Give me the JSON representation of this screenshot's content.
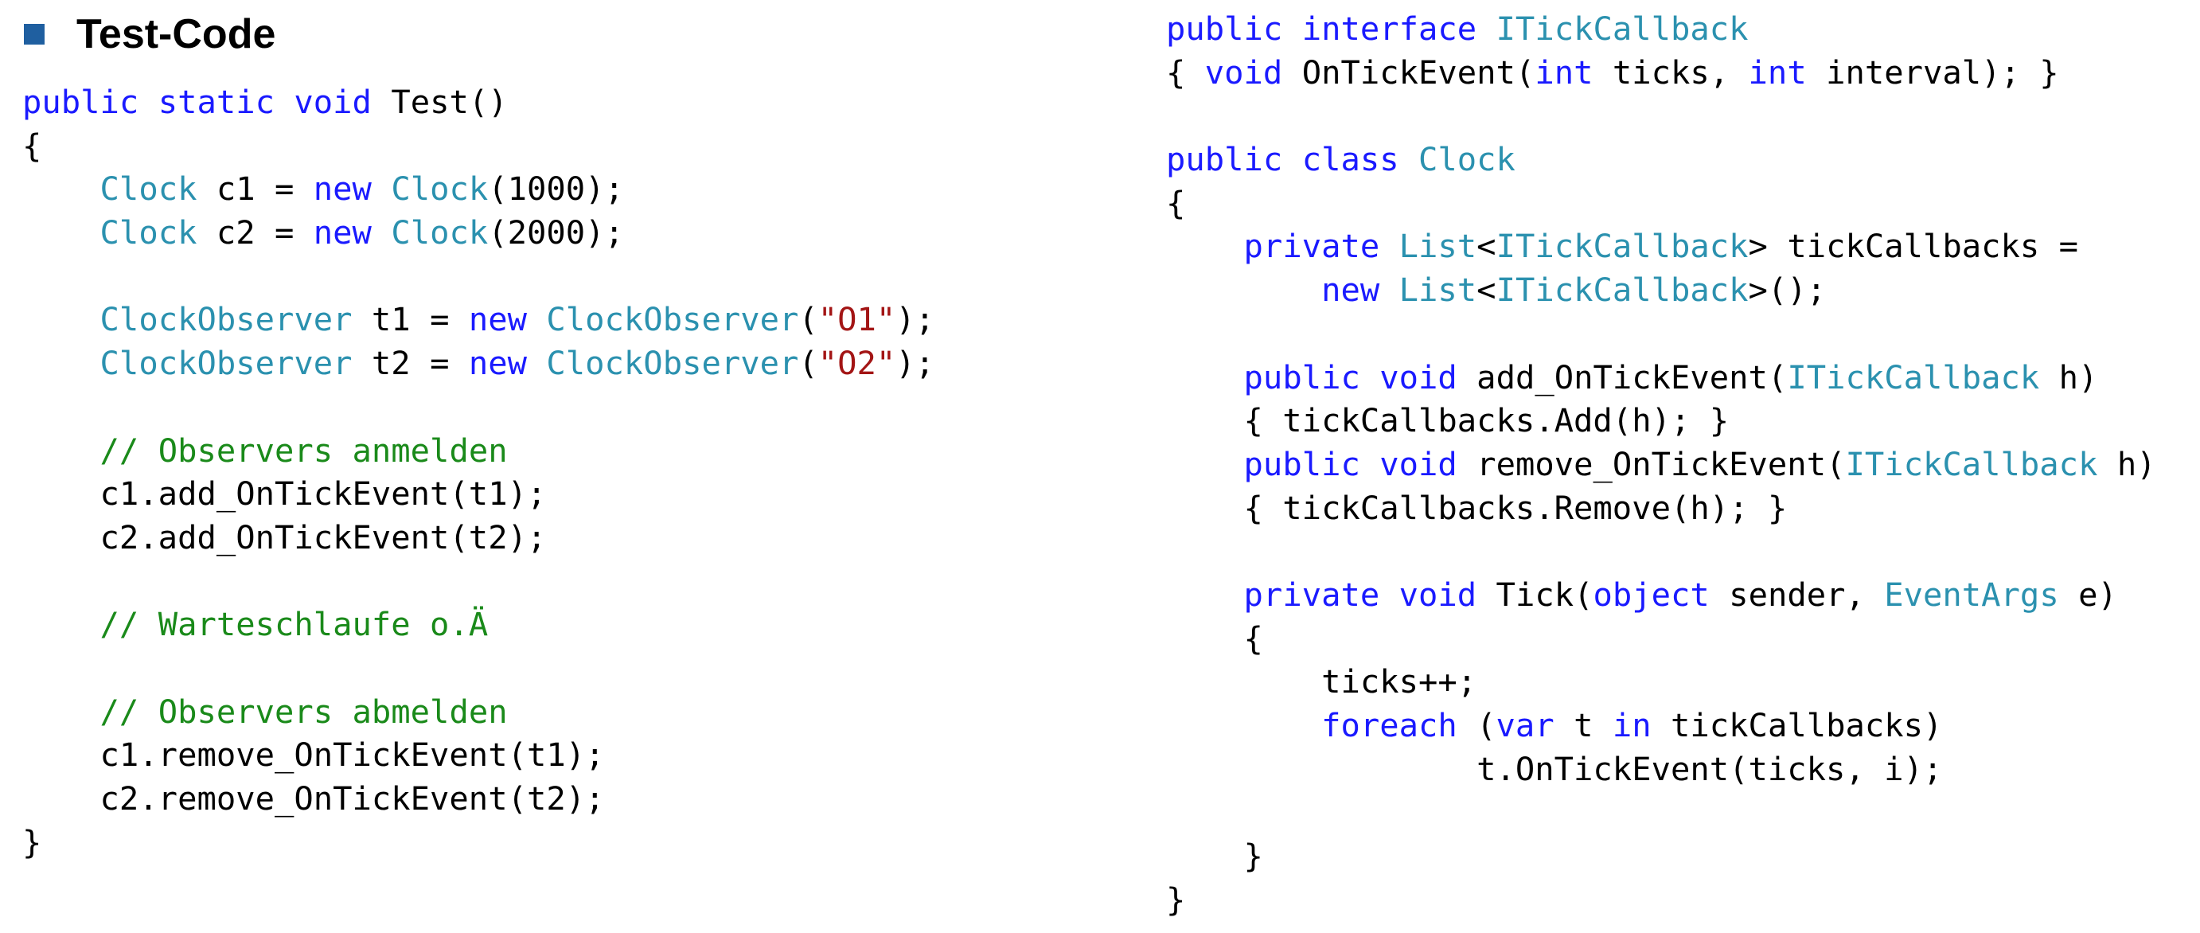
{
  "slide": {
    "title": "Test-Code"
  },
  "colors": {
    "keyword": "#1a1aff",
    "type": "#2b91af",
    "string": "#a31515",
    "comment": "#1a8a1a",
    "plain": "#000000",
    "bullet": "#1f5fa0"
  },
  "left_code": [
    [
      [
        "kw",
        "public"
      ],
      [
        "pl",
        " "
      ],
      [
        "kw",
        "static"
      ],
      [
        "pl",
        " "
      ],
      [
        "kw",
        "void"
      ],
      [
        "pl",
        " Test()"
      ]
    ],
    [
      [
        "pl",
        "{"
      ]
    ],
    [
      [
        "pl",
        "    "
      ],
      [
        "ty",
        "Clock"
      ],
      [
        "pl",
        " c1 = "
      ],
      [
        "kw",
        "new"
      ],
      [
        "pl",
        " "
      ],
      [
        "ty",
        "Clock"
      ],
      [
        "pl",
        "(1000);"
      ]
    ],
    [
      [
        "pl",
        "    "
      ],
      [
        "ty",
        "Clock"
      ],
      [
        "pl",
        " c2 = "
      ],
      [
        "kw",
        "new"
      ],
      [
        "pl",
        " "
      ],
      [
        "ty",
        "Clock"
      ],
      [
        "pl",
        "(2000);"
      ]
    ],
    [],
    [
      [
        "pl",
        "    "
      ],
      [
        "ty",
        "ClockObserver"
      ],
      [
        "pl",
        " t1 = "
      ],
      [
        "kw",
        "new"
      ],
      [
        "pl",
        " "
      ],
      [
        "ty",
        "ClockObserver"
      ],
      [
        "pl",
        "("
      ],
      [
        "st",
        "\"O1\""
      ],
      [
        "pl",
        ");"
      ]
    ],
    [
      [
        "pl",
        "    "
      ],
      [
        "ty",
        "ClockObserver"
      ],
      [
        "pl",
        " t2 = "
      ],
      [
        "kw",
        "new"
      ],
      [
        "pl",
        " "
      ],
      [
        "ty",
        "ClockObserver"
      ],
      [
        "pl",
        "("
      ],
      [
        "st",
        "\"O2\""
      ],
      [
        "pl",
        ");"
      ]
    ],
    [],
    [
      [
        "pl",
        "    "
      ],
      [
        "cm",
        "// Observers anmelden"
      ]
    ],
    [
      [
        "pl",
        "    c1.add_OnTickEvent(t1);"
      ]
    ],
    [
      [
        "pl",
        "    c2.add_OnTickEvent(t2);"
      ]
    ],
    [],
    [
      [
        "pl",
        "    "
      ],
      [
        "cm",
        "// Warteschlaufe o.Ä"
      ]
    ],
    [],
    [
      [
        "pl",
        "    "
      ],
      [
        "cm",
        "// Observers abmelden"
      ]
    ],
    [
      [
        "pl",
        "    c1.remove_OnTickEvent(t1);"
      ]
    ],
    [
      [
        "pl",
        "    c2.remove_OnTickEvent(t2);"
      ]
    ],
    [
      [
        "pl",
        "}"
      ]
    ]
  ],
  "right_code": [
    [
      [
        "kw",
        "public"
      ],
      [
        "pl",
        " "
      ],
      [
        "kw",
        "interface"
      ],
      [
        "pl",
        " "
      ],
      [
        "ty",
        "ITickCallback"
      ]
    ],
    [
      [
        "pl",
        "{ "
      ],
      [
        "kw",
        "void"
      ],
      [
        "pl",
        " OnTickEvent("
      ],
      [
        "kw",
        "int"
      ],
      [
        "pl",
        " ticks, "
      ],
      [
        "kw",
        "int"
      ],
      [
        "pl",
        " interval); }"
      ]
    ],
    [],
    [
      [
        "kw",
        "public"
      ],
      [
        "pl",
        " "
      ],
      [
        "kw",
        "class"
      ],
      [
        "pl",
        " "
      ],
      [
        "ty",
        "Clock"
      ]
    ],
    [
      [
        "pl",
        "{"
      ]
    ],
    [
      [
        "pl",
        "    "
      ],
      [
        "kw",
        "private"
      ],
      [
        "pl",
        " "
      ],
      [
        "ty",
        "List"
      ],
      [
        "pl",
        "<"
      ],
      [
        "ty",
        "ITickCallback"
      ],
      [
        "pl",
        "> tickCallbacks ="
      ]
    ],
    [
      [
        "pl",
        "        "
      ],
      [
        "kw",
        "new"
      ],
      [
        "pl",
        " "
      ],
      [
        "ty",
        "List"
      ],
      [
        "pl",
        "<"
      ],
      [
        "ty",
        "ITickCallback"
      ],
      [
        "pl",
        ">();"
      ]
    ],
    [],
    [
      [
        "pl",
        "    "
      ],
      [
        "kw",
        "public"
      ],
      [
        "pl",
        " "
      ],
      [
        "kw",
        "void"
      ],
      [
        "pl",
        " add_OnTickEvent("
      ],
      [
        "ty",
        "ITickCallback"
      ],
      [
        "pl",
        " h)"
      ]
    ],
    [
      [
        "pl",
        "    { tickCallbacks.Add(h); }"
      ]
    ],
    [
      [
        "pl",
        "    "
      ],
      [
        "kw",
        "public"
      ],
      [
        "pl",
        " "
      ],
      [
        "kw",
        "void"
      ],
      [
        "pl",
        " remove_OnTickEvent("
      ],
      [
        "ty",
        "ITickCallback"
      ],
      [
        "pl",
        " h)"
      ]
    ],
    [
      [
        "pl",
        "    { tickCallbacks.Remove(h); }"
      ]
    ],
    [],
    [
      [
        "pl",
        "    "
      ],
      [
        "kw",
        "private"
      ],
      [
        "pl",
        " "
      ],
      [
        "kw",
        "void"
      ],
      [
        "pl",
        " Tick("
      ],
      [
        "kw",
        "object"
      ],
      [
        "pl",
        " sender, "
      ],
      [
        "ty",
        "EventArgs"
      ],
      [
        "pl",
        " e)"
      ]
    ],
    [
      [
        "pl",
        "    {"
      ]
    ],
    [
      [
        "pl",
        "        ticks++;"
      ]
    ],
    [
      [
        "pl",
        "        "
      ],
      [
        "kw",
        "foreach"
      ],
      [
        "pl",
        " ("
      ],
      [
        "kw",
        "var"
      ],
      [
        "pl",
        " t "
      ],
      [
        "kw",
        "in"
      ],
      [
        "pl",
        " tickCallbacks)"
      ]
    ],
    [
      [
        "pl",
        "                t.OnTickEvent(ticks, i);"
      ]
    ],
    [],
    [
      [
        "pl",
        "    }"
      ]
    ],
    [
      [
        "pl",
        "}"
      ]
    ]
  ]
}
